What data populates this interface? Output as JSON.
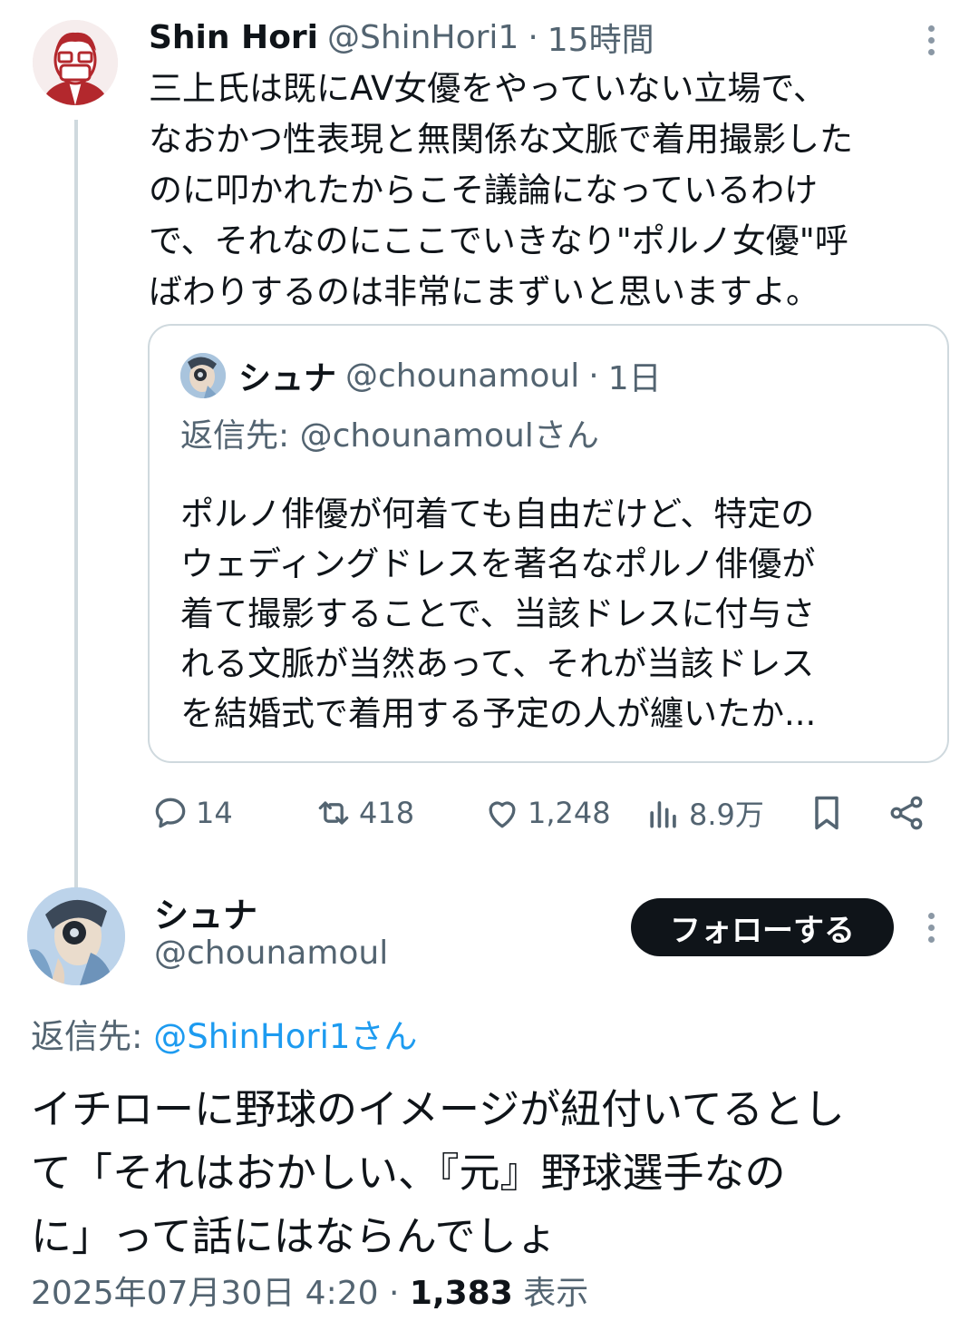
{
  "parent": {
    "name": "Shin Hori",
    "handle": "@ShinHori1",
    "sep": "·",
    "time": "15時間",
    "text": "三上氏は既にAV女優をやっていない立場で、\nなおかつ性表現と無関係な文脈で着用撮影した\nのに叩かれたからこそ議論になっているわけ\nで、それなのにここでいきなり\"ポルノ女優\"呼\nばわりするのは非常にまずいと思いますよ。",
    "quote": {
      "name": "シュナ",
      "handle": "@chounamoul",
      "sep": "·",
      "time": "1日",
      "reply_label": "返信先: @chounamoulさん",
      "text": "ポルノ俳優が何着ても自由だけど、特定の\nウェディングドレスを著名なポルノ俳優が\n着て撮影することで、当該ドレスに付与さ\nれる文脈が当然あって、それが当該ドレス\nを結婚式で着用する予定の人が纏いたか..."
    },
    "actions": {
      "replies": "14",
      "retweets": "418",
      "likes": "1,248",
      "views": "8.9万"
    }
  },
  "reply": {
    "name": "シュナ",
    "handle": "@chounamoul",
    "follow_label": "フォローする",
    "reply_prefix": "返信先: ",
    "reply_to": "@ShinHori1さん",
    "text": "イチローに野球のイメージが紐付いてるとし\nて「それはおかしい、『元』野球選手なの\nに」って話にはならんでしょ",
    "date": "2025年07月30日 4:20",
    "sep": "·",
    "views_count": "1,383",
    "views_label": "表示"
  },
  "colors": {
    "text": "#0f1419",
    "secondary": "#536471",
    "link": "#1d9bf0",
    "border": "#cfd9de",
    "button_bg": "#0f1419"
  },
  "icons": [
    "reply-icon",
    "retweet-icon",
    "like-icon",
    "views-icon",
    "bookmark-icon",
    "share-icon",
    "more-icon"
  ]
}
